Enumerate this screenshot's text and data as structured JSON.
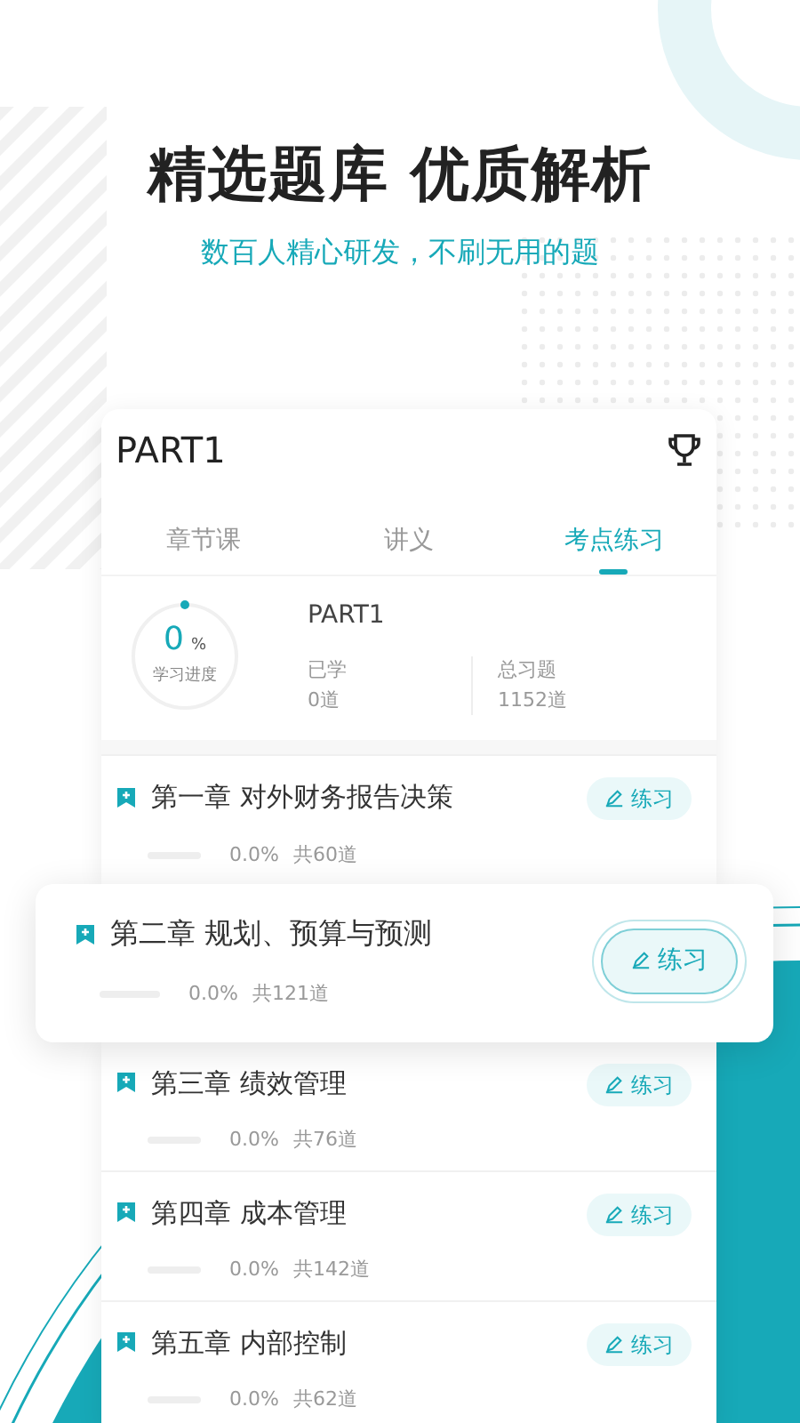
{
  "headline": "精选题库 优质解析",
  "subheadline": "数百人精心研发，不刷无用的题",
  "card": {
    "title": "PART1",
    "tabs": [
      {
        "label": "章节课",
        "selected": false
      },
      {
        "label": "讲义",
        "selected": false
      },
      {
        "label": "考点练习",
        "selected": true
      }
    ],
    "progress": {
      "percent": "0",
      "unit": "%",
      "caption": "学习进度",
      "level": 0,
      "name": "PART1",
      "stats": [
        {
          "label": "已学",
          "value": "0道"
        },
        {
          "label": "总习题",
          "value": "1152道"
        }
      ]
    },
    "chapters": [
      {
        "title": "第一章 对外财务报告决策",
        "level": 0,
        "percent": "0.0%",
        "count": "共60道",
        "button": "练习",
        "selected": false
      },
      {
        "title": "第二章 规划、预算与预测",
        "level": 0,
        "percent": "0.0%",
        "count": "共121道",
        "button": "练习",
        "selected": true
      },
      {
        "title": "第三章 绩效管理",
        "level": 0,
        "percent": "0.0%",
        "count": "共76道",
        "button": "练习",
        "selected": false
      },
      {
        "title": "第四章 成本管理",
        "level": 0,
        "percent": "0.0%",
        "count": "共142道",
        "button": "练习",
        "selected": false
      },
      {
        "title": "第五章 内部控制",
        "level": 0,
        "percent": "0.0%",
        "count": "共62道",
        "button": "练习",
        "selected": false
      }
    ]
  }
}
